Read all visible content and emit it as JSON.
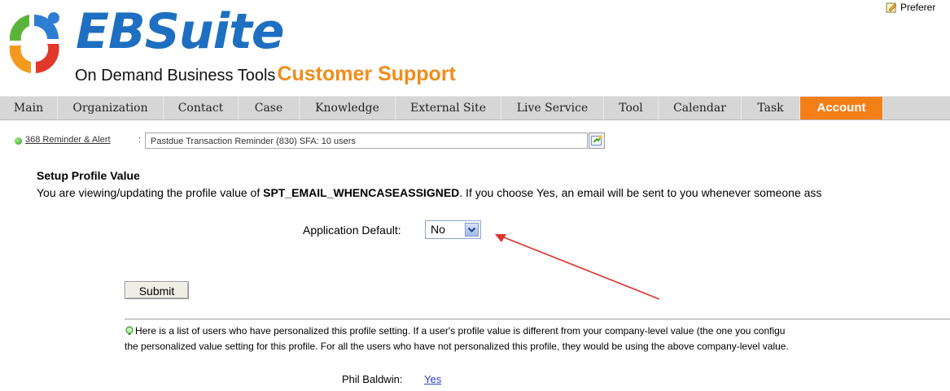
{
  "header": {
    "brand": "EBSuite",
    "tagline": "On Demand Business Tools",
    "product": "Customer Support",
    "preferences_label": "Preferer"
  },
  "nav": {
    "tabs": [
      {
        "label": "Main",
        "active": false
      },
      {
        "label": "Organization",
        "active": false
      },
      {
        "label": "Contact",
        "active": false
      },
      {
        "label": "Case",
        "active": false
      },
      {
        "label": "Knowledge",
        "active": false
      },
      {
        "label": "External Site",
        "active": false
      },
      {
        "label": "Live Service",
        "active": false
      },
      {
        "label": "Tool",
        "active": false
      },
      {
        "label": "Calendar",
        "active": false
      },
      {
        "label": "Task",
        "active": false
      },
      {
        "label": "Account",
        "active": true
      }
    ]
  },
  "reminder": {
    "link": "368 Reminder & Alert",
    "colon": ":",
    "selected": "Pastdue Transaction Reminder (830) SFA: 10 users"
  },
  "profile": {
    "title": "Setup Profile Value",
    "desc_prefix": "You are viewing/updating the profile value of ",
    "profile_name": "SPT_EMAIL_WHENCASEASSIGNED",
    "desc_suffix": ". If you choose Yes, an email will be sent to you whenever someone ass",
    "app_default_label": "Application Default:",
    "app_default_value": "No",
    "submit_label": "Submit"
  },
  "tip": {
    "line1": "Here is a list of users who have personalized this profile setting. If a user's profile value is different from your company-level value (the one you configu",
    "line2": "the personalized value setting for this profile. For all the users who have not personalized this profile, they would be using the above company-level value."
  },
  "users": [
    {
      "name": "Phil Baldwin:",
      "value": "Yes"
    }
  ],
  "colors": {
    "brand_blue": "#1e6fc1",
    "brand_orange": "#f28c1b",
    "active_tab": "#f57f17",
    "nav_bg": "#d6d6d6",
    "annotation_arrow": "#e0312b"
  }
}
